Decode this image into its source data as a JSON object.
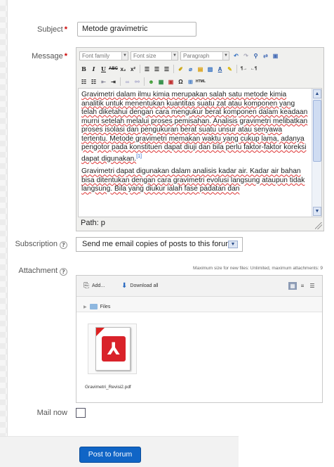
{
  "form": {
    "subject_label": "Subject",
    "required_mark": "*",
    "subject_value": "Metode gravimetric",
    "message_label": "Message",
    "subscription_label": "Subscription",
    "subscription_value": "Send me email copies of posts to this forum",
    "attachment_label": "Attachment",
    "max_size_text": "Maximum size for new files: Unlimited, maximum attachments: 9",
    "mail_now_label": "Mail now",
    "mail_now_checked": false,
    "submit_label": "Post to forum",
    "help_glyph": "?"
  },
  "editor": {
    "font_family": "Font family",
    "font_size": "Font size",
    "format": "Paragraph",
    "path": "Path: p",
    "paragraph1": "Gravimetri dalam ilmu kimia merupakan salah satu metode kimia analitik untuk menentukan kuantitas suatu zat atau komponen yang telah diketahui dengan cara mengukur berat komponen dalam keadaan murni setelah melalui proses pemisahan. Analisis gravimetri melibatkan proses isolasi dan pengukuran berat suatu unsur atau senyawa tertentu. Metode gravimetri memakan waktu yang cukup lama, adanya pengotor pada konstituen dapat diuji dan bila perlu faktor-faktor koreksi dapat digunakan.",
    "footnote": "[1]",
    "paragraph2": "Gravimetri dapat digunakan dalam analisis kadar air. Kadar air bahan bisa ditentukan dengan cara gravimetri evolusi langsung ataupun tidak langsung. Bila yang diukur ialah fase padatan dan"
  },
  "filemanager": {
    "add_label": "Add...",
    "download_all_label": "Download all",
    "files_folder_label": "Files",
    "file_name": "Gravimetri_Revisi2.pdf"
  },
  "colors": {
    "accent": "#1065c6",
    "required": "#cc0000",
    "link": "#1a5ac8"
  }
}
